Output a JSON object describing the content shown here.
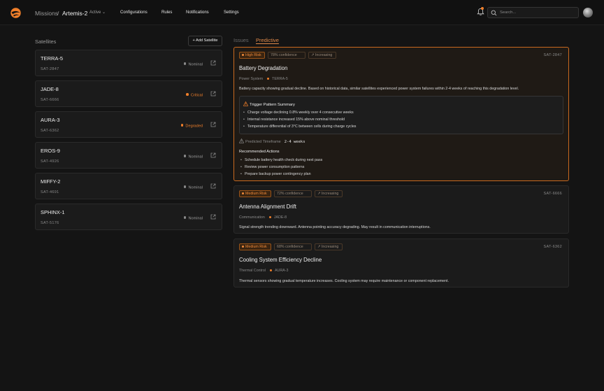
{
  "header": {
    "breadcrumb_root": "Missions",
    "breadcrumb_sep": "/",
    "mission_name": "Artemis-2",
    "mission_status": "Active",
    "nav": [
      "Configurations",
      "Rules",
      "Notifications",
      "Settings"
    ],
    "search_placeholder": "Search..."
  },
  "satellites": {
    "heading": "Satellites",
    "add_label": "+ Add Satellite",
    "items": [
      {
        "name": "TERRA-5",
        "id": "SAT-2847",
        "status": "Nominal",
        "color": "#8a8a8a"
      },
      {
        "name": "JADE-8",
        "id": "SAT-6666",
        "status": "Critical",
        "color": "#f07f2a"
      },
      {
        "name": "AURA-3",
        "id": "SAT-6362",
        "status": "Degraded",
        "color": "#f07f2a"
      },
      {
        "name": "EROS-9",
        "id": "SAT-4926",
        "status": "Nominal",
        "color": "#8a8a8a"
      },
      {
        "name": "MIFFY-2",
        "id": "SAT-4691",
        "status": "Nominal",
        "color": "#8a8a8a"
      },
      {
        "name": "SPHINX-1",
        "id": "SAT-5176",
        "status": "Nominal",
        "color": "#8a8a8a"
      }
    ]
  },
  "tabs": {
    "issues": "Issues",
    "predictive": "Predictive"
  },
  "issues": [
    {
      "risk": "High Risk",
      "confidence": "78% confidence",
      "trend": "Increasing",
      "sat_id": "SAT-2847",
      "title": "Battery Degradation",
      "subsystem": "Power System",
      "satellite": "TERRA-5",
      "description": "Battery capacity showing gradual decline. Based on historical data, similar satellites experienced power system failures within 2-4 weeks of reaching this degradation level.",
      "trigger_title": "Trigger Pattern Summary",
      "triggers": [
        "Charge voltage declining 0.8% weekly over 4 consecutive weeks",
        "Internal resistance increased 15% above nominal threshold",
        "Temperature differential of 3°C between cells during charge cycles"
      ],
      "timeframe_label": "Predicted Timeframe",
      "timeframe_value": "2-4 weeks",
      "actions_title": "Recommended Actions",
      "actions": [
        "Schedule battery health check during next pass",
        "Review power consumption patterns",
        "Prepare backup power contingency plan"
      ]
    },
    {
      "risk": "Medium Risk",
      "confidence": "72% confidence",
      "trend": "Increasing",
      "sat_id": "SAT-6666",
      "title": "Antenna Alignment Drift",
      "subsystem": "Communication",
      "satellite": "JADE-8",
      "description": "Signal strength trending downward. Antenna pointing accuracy degrading. May result in communication interruptions."
    },
    {
      "risk": "Medium Risk",
      "confidence": "68% confidence",
      "trend": "Increasing",
      "sat_id": "SAT-6362",
      "title": "Cooling System Efficiency Decline",
      "subsystem": "Thermal Control",
      "satellite": "AURA-3",
      "description": "Thermal sensors showing gradual temperature increases. Cooling system may require maintenance or component replacement."
    }
  ],
  "colors": {
    "accent": "#f07f2a",
    "background": "#141414",
    "card": "#1b1b1b"
  }
}
